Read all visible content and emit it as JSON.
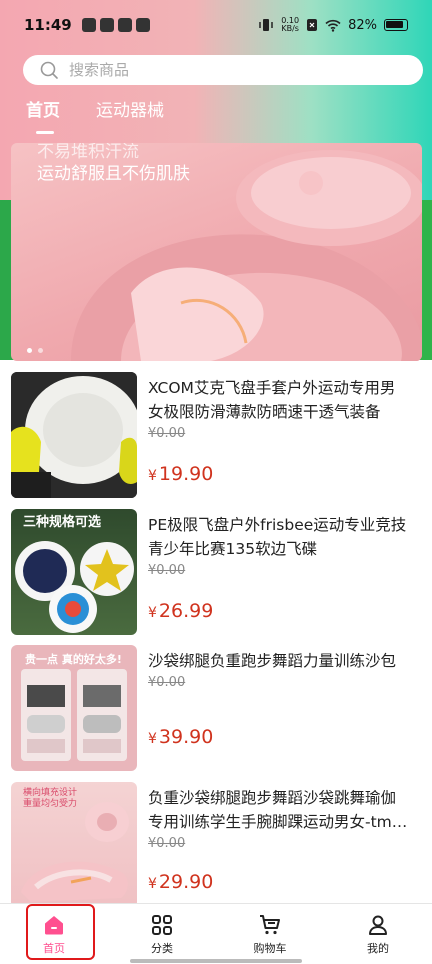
{
  "status_bar": {
    "time": "11:49",
    "net_speed_top": "0.10",
    "net_speed_bottom": "KB/s",
    "battery": "82%"
  },
  "search": {
    "placeholder": "搜索商品"
  },
  "tabs": [
    {
      "label": "首页",
      "active": true
    },
    {
      "label": "运动器械",
      "active": false
    }
  ],
  "banner": {
    "line1": "不易堆积汗流",
    "line2": "运动舒服且不伤肌肤"
  },
  "products": [
    {
      "title": "XCOM艾克飞盘手套户外运动专用男女极限防滑薄款防晒速干透气装备",
      "original_price": "¥0.00",
      "price_symbol": "¥",
      "price": "19.90"
    },
    {
      "title": "PE极限飞盘户外frisbee运动专业竞技青少年比赛135软边飞碟",
      "original_price": "¥0.00",
      "price_symbol": "¥",
      "price": "26.99",
      "thumb_text": "三种规格可选"
    },
    {
      "title": "沙袋绑腿负重跑步舞蹈力量训练沙包",
      "original_price": "¥0.00",
      "price_symbol": "¥",
      "price": "39.90",
      "thumb_text": "贵一点 真的好太多!"
    },
    {
      "title": "负重沙袋绑腿跑步舞蹈沙袋跳舞瑜伽专用训练学生手腕脚踝运动男女-tm…",
      "original_price": "¥0.00",
      "price_symbol": "¥",
      "price": "29.90",
      "thumb_text": "横向填充设计 重量均匀受力"
    }
  ],
  "bottom_nav": [
    {
      "label": "首页",
      "icon": "home-icon",
      "active": true
    },
    {
      "label": "分类",
      "icon": "grid-icon",
      "active": false
    },
    {
      "label": "购物车",
      "icon": "cart-icon",
      "active": false
    },
    {
      "label": "我的",
      "icon": "user-icon",
      "active": false
    }
  ],
  "colors": {
    "accent": "#ff4f8f",
    "price": "#d0331e",
    "highlight": "#e0191b"
  }
}
